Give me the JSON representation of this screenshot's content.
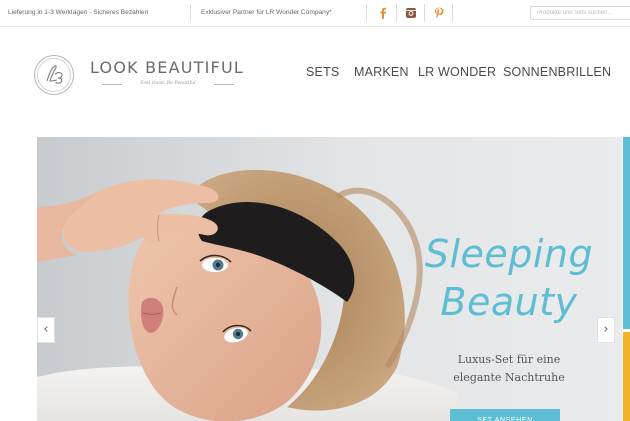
{
  "topbar": {
    "shipping": "Lieferung in 1-3 Werktagen - Sicheres Bezahlen",
    "partner": "Exklusiver Partner für LR Wonder Company*",
    "search_placeholder": "Produkte und Sets suchen..."
  },
  "social": {
    "facebook_color": "#3b5998",
    "instagram_color": "#8a5a44",
    "pinterest_color": "#cb2027",
    "icons": [
      "facebook-icon",
      "instagram-icon",
      "pinterest-icon"
    ]
  },
  "brand": {
    "monogram": "LB",
    "name": "LOOK BEAUTIFUL",
    "tagline": "Feel Good. Be Beautiful"
  },
  "nav": {
    "items": [
      "SETS",
      "MARKEN",
      "LR WONDER",
      "SONNENBRILLEN"
    ]
  },
  "hero": {
    "title_line1": "Sleeping",
    "title_line2": "Beauty",
    "subtitle_line1": "Luxus-Set für eine",
    "subtitle_line2": "elegante Nachtruhe",
    "cta_label": "SET ANSEHEN",
    "prev_icon": "‹",
    "next_icon": "›",
    "accent_color": "#5cbdd3"
  }
}
